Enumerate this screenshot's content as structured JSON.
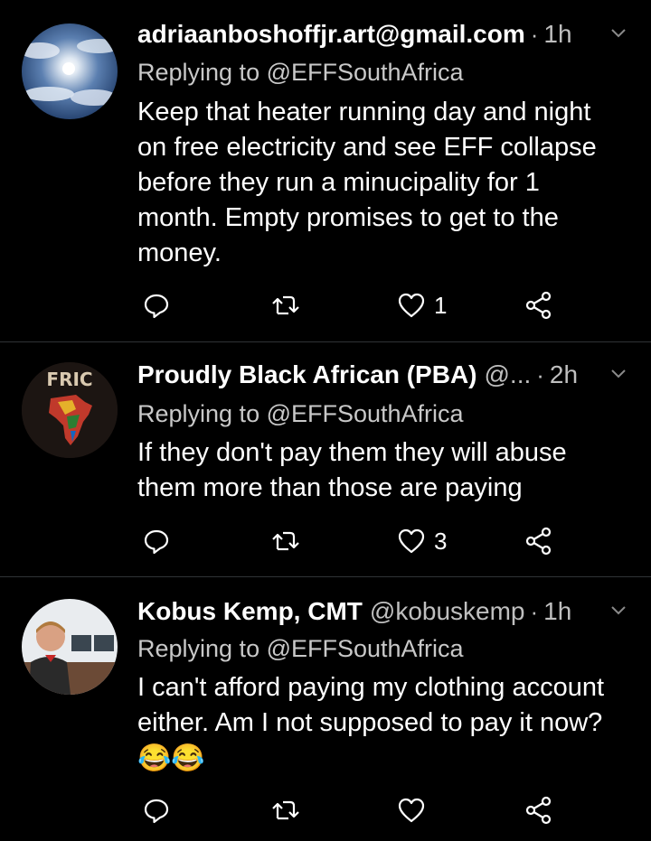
{
  "tweets": [
    {
      "name": "adriaanboshoffjr.art@gmail.com",
      "handle": "",
      "time": "1h",
      "replying": "Replying to @EFFSouthAfrica",
      "lines": [
        "Keep that heater running day and night",
        "on free electricity and see EFF collapse",
        "before they run a minucipality for 1",
        "month. Empty promises to get to the",
        "money."
      ],
      "likes": "1"
    },
    {
      "name": "Proudly Black African (PBA)",
      "handle": "@...",
      "time": "2h",
      "replying": "Replying to @EFFSouthAfrica",
      "lines": [
        "If they don't pay them they will abuse",
        "them more than those are paying"
      ],
      "likes": "3"
    },
    {
      "name": "Kobus Kemp, CMT",
      "handle": "@kobuskemp",
      "time": "1h",
      "replying": "Replying to @EFFSouthAfrica",
      "lines": [
        "I can't afford paying my clothing account",
        "either. Am I not supposed to pay it now?"
      ],
      "emoji": "😂😂",
      "likes": ""
    }
  ],
  "icons": {
    "reply": "reply-icon",
    "retweet": "retweet-icon",
    "like": "heart-icon",
    "share": "share-icon",
    "menu": "chevron-down-icon"
  },
  "colors": {
    "background": "#000000",
    "muted": "#bfbfbf",
    "divider": "#2f3336"
  }
}
